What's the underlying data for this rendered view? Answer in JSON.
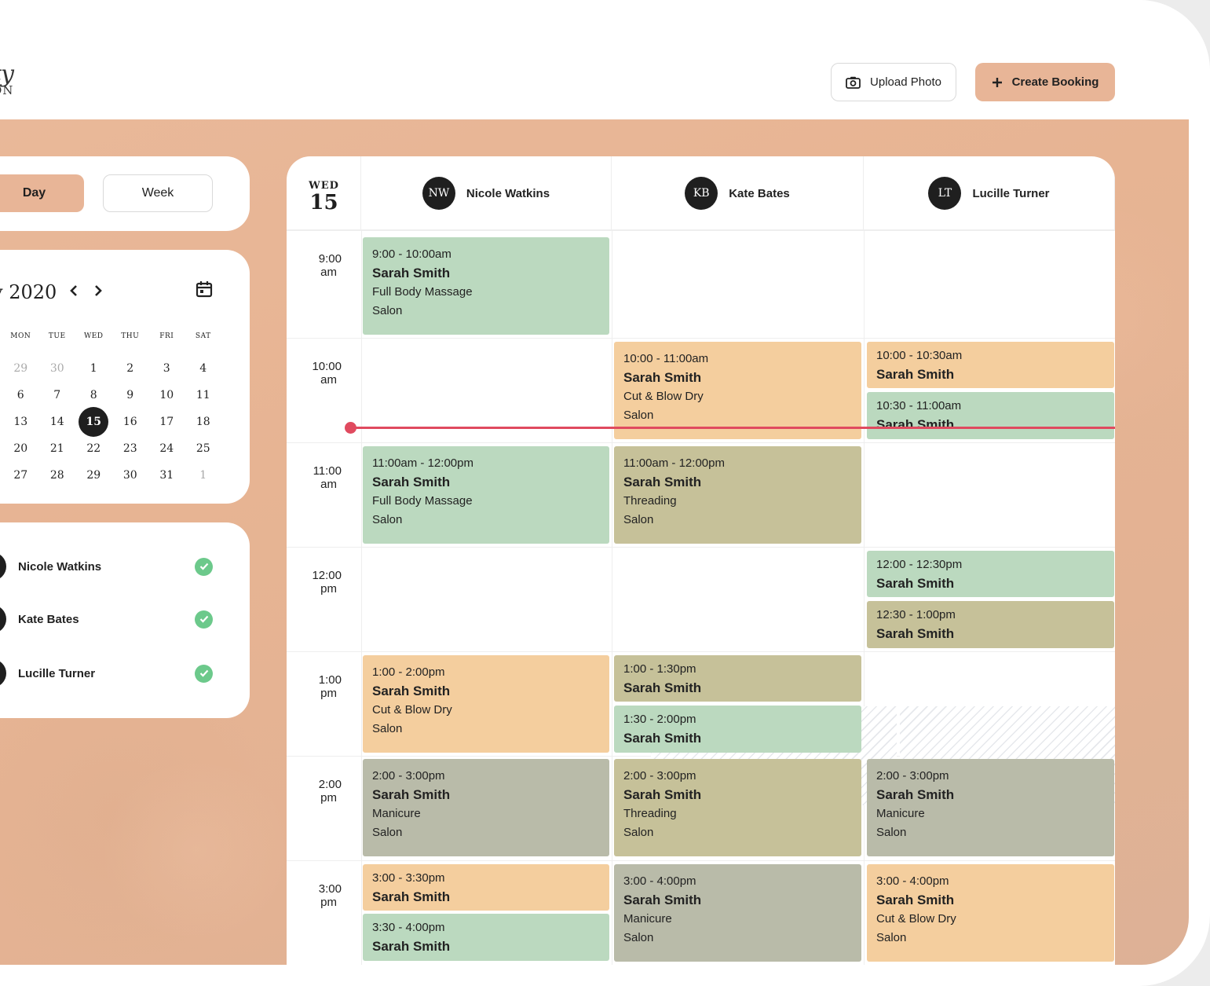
{
  "header": {
    "logo_script": "ty",
    "logo_sub": "ON",
    "upload_label": "Upload Photo",
    "create_label": "Create Booking"
  },
  "view": {
    "day_label": "Day",
    "week_label": "Week",
    "active": "Day"
  },
  "calendar": {
    "title": "y 2020",
    "weekdays": [
      "MON",
      "TUE",
      "WED",
      "THU",
      "FRI",
      "SAT"
    ],
    "weeks": [
      [
        "29",
        "30",
        "1",
        "2",
        "3",
        "4"
      ],
      [
        "6",
        "7",
        "8",
        "9",
        "10",
        "11"
      ],
      [
        "13",
        "14",
        "15",
        "16",
        "17",
        "18"
      ],
      [
        "20",
        "21",
        "22",
        "23",
        "24",
        "25"
      ],
      [
        "27",
        "28",
        "29",
        "30",
        "31",
        "1"
      ]
    ],
    "selected": "15"
  },
  "staff_list": [
    {
      "name": "Nicole Watkins"
    },
    {
      "name": "Kate Bates"
    },
    {
      "name": "Lucille Turner"
    }
  ],
  "schedule": {
    "day_of_week": "WED",
    "day_num": "15",
    "columns": [
      {
        "initials": "NW",
        "name": "Nicole Watkins"
      },
      {
        "initials": "KB",
        "name": "Kate Bates"
      },
      {
        "initials": "LT",
        "name": "Lucille Turner"
      }
    ],
    "times": [
      {
        "h": "9:00",
        "p": "am"
      },
      {
        "h": "10:00",
        "p": "am"
      },
      {
        "h": "11:00",
        "p": "am"
      },
      {
        "h": "12:00",
        "p": "pm"
      },
      {
        "h": "1:00",
        "p": "pm"
      },
      {
        "h": "2:00",
        "p": "pm"
      },
      {
        "h": "3:00",
        "p": "pm"
      }
    ],
    "bookings": [
      {
        "time": "9:00 - 10:00am",
        "client": "Sarah Smith",
        "service": "Full Body Massage",
        "location": "Salon",
        "color": "#bbd9bf"
      },
      {
        "time": "11:00am - 12:00pm",
        "client": "Sarah Smith",
        "service": "Full Body Massage",
        "location": "Salon",
        "color": "#bbd9bf"
      },
      {
        "time": "1:00 - 2:00pm",
        "client": "Sarah Smith",
        "service": "Cut & Blow Dry",
        "location": "Salon",
        "color": "#f4ce9e"
      },
      {
        "time": "2:00 - 3:00pm",
        "client": "Sarah Smith",
        "service": "Manicure",
        "location": "Salon",
        "color": "#b9bba9"
      },
      {
        "time": "3:00 - 3:30pm",
        "client": "Sarah Smith",
        "color": "#f4ce9e"
      },
      {
        "time": "3:30 - 4:00pm",
        "client": "Sarah Smith",
        "color": "#bbd9bf"
      },
      {
        "time": "10:00 - 11:00am",
        "client": "Sarah Smith",
        "service": "Cut & Blow Dry",
        "location": "Salon",
        "color": "#f4ce9e"
      },
      {
        "time": "11:00am - 12:00pm",
        "client": "Sarah Smith",
        "service": "Threading",
        "location": "Salon",
        "color": "#c6c199"
      },
      {
        "time": "1:00 - 1:30pm",
        "client": "Sarah Smith",
        "color": "#c6c199"
      },
      {
        "time": "1:30 - 2:00pm",
        "client": "Sarah Smith",
        "color": "#bbd9bf"
      },
      {
        "time": "2:00 - 3:00pm",
        "client": "Sarah Smith",
        "service": "Threading",
        "location": "Salon",
        "color": "#c6c199"
      },
      {
        "time": "3:00 - 4:00pm",
        "client": "Sarah Smith",
        "service": "Manicure",
        "location": "Salon",
        "color": "#b9bba9"
      },
      {
        "time": "10:00 - 10:30am",
        "client": "Sarah Smith",
        "color": "#f4ce9e"
      },
      {
        "time": "10:30 - 11:00am",
        "client": "Sarah Smith",
        "color": "#bbd9bf"
      },
      {
        "time": "12:00 - 12:30pm",
        "client": "Sarah Smith",
        "color": "#bbd9bf"
      },
      {
        "time": "12:30 - 1:00pm",
        "client": "Sarah Smith",
        "color": "#c6c199"
      },
      {
        "time": "2:00 - 3:00pm",
        "client": "Sarah Smith",
        "service": "Manicure",
        "location": "Salon",
        "color": "#b9bba9"
      },
      {
        "time": "3:00 - 4:00pm",
        "client": "Sarah Smith",
        "service": "Cut & Blow Dry",
        "location": "Salon",
        "color": "#f4ce9e"
      }
    ]
  },
  "icons": {
    "upload": "camera-icon",
    "create": "plus-icon",
    "calendar": "calendar-icon",
    "check": "check-icon"
  }
}
